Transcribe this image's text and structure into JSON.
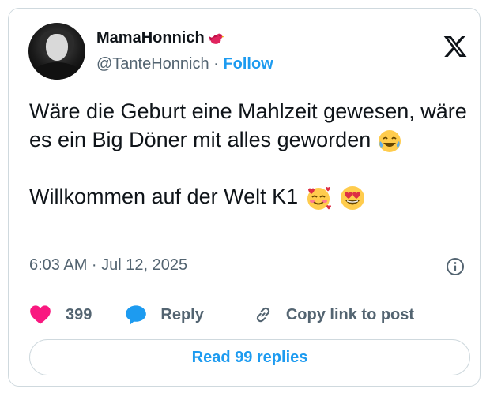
{
  "author": {
    "display_name": "MamaHonnich",
    "handle": "@TanteHonnich",
    "separator": " · ",
    "follow_label": "Follow"
  },
  "tweet": {
    "line1": "Wäre die Geburt eine Mahlzeit gewesen, wäre es ein Big Döner mit alles geworden",
    "line2": "Willkommen auf der Welt K1",
    "emojis_line1": [
      "face-with-tears-of-joy"
    ],
    "emojis_line2": [
      "smiling-face-with-hearts",
      "heart-eyes-face"
    ],
    "timestamp": "6:03 AM · Jul 12, 2025"
  },
  "actions": {
    "like_count": "399",
    "reply_label": "Reply",
    "copy_link_label": "Copy link to post"
  },
  "read_replies_label": "Read 99 replies",
  "colors": {
    "accent": "#1d9bf0",
    "like": "#f91880",
    "text": "#0f1419",
    "secondary": "#536471",
    "border": "#cfd9de"
  },
  "icons": [
    "x-logo-icon",
    "bird-icon",
    "info-icon",
    "heart-icon",
    "reply-bubble-icon",
    "link-icon"
  ]
}
